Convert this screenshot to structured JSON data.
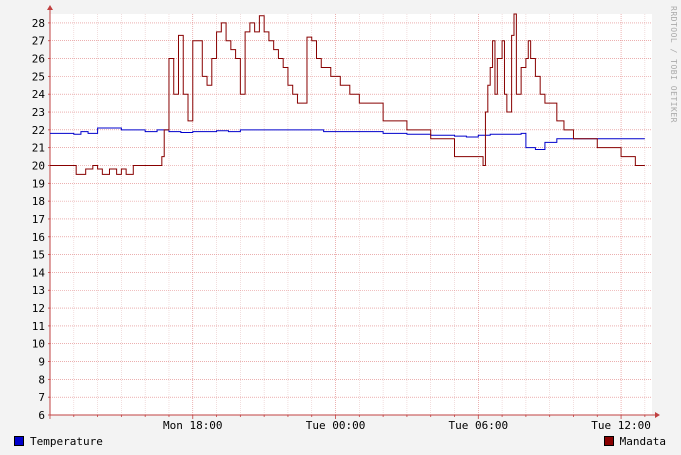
{
  "watermark": "RRDTOOL / TOBI OETIKER",
  "chart_data": {
    "type": "line",
    "xlabel": "",
    "ylabel": "",
    "ylim": [
      6,
      28.5
    ],
    "yticks": [
      6,
      7,
      8,
      9,
      10,
      11,
      12,
      13,
      14,
      15,
      16,
      17,
      18,
      19,
      20,
      21,
      22,
      23,
      24,
      25,
      26,
      27,
      28
    ],
    "xlim": [
      12,
      37.3
    ],
    "xticks": [
      {
        "x": 18,
        "label": "Mon 18:00"
      },
      {
        "x": 24,
        "label": "Tue 00:00"
      },
      {
        "x": 30,
        "label": "Tue 06:00"
      },
      {
        "x": 36,
        "label": "Tue 12:00"
      }
    ],
    "grid": true,
    "legend_position": "bottom",
    "series": [
      {
        "name": "Temperature",
        "color": "#0000cc",
        "points": [
          [
            12.0,
            21.8
          ],
          [
            12.5,
            21.8
          ],
          [
            13.0,
            21.75
          ],
          [
            13.3,
            21.9
          ],
          [
            13.6,
            21.8
          ],
          [
            14.0,
            22.1
          ],
          [
            14.5,
            22.1
          ],
          [
            15.0,
            22.0
          ],
          [
            15.5,
            22.0
          ],
          [
            16.0,
            21.9
          ],
          [
            16.5,
            22.0
          ],
          [
            17.0,
            21.9
          ],
          [
            17.5,
            21.85
          ],
          [
            18.0,
            21.9
          ],
          [
            18.5,
            21.9
          ],
          [
            19.0,
            21.95
          ],
          [
            19.5,
            21.9
          ],
          [
            20.0,
            22.0
          ],
          [
            20.5,
            22.0
          ],
          [
            21.0,
            22.0
          ],
          [
            21.5,
            22.0
          ],
          [
            22.0,
            22.0
          ],
          [
            22.5,
            22.0
          ],
          [
            23.0,
            22.0
          ],
          [
            23.5,
            21.9
          ],
          [
            24.0,
            21.9
          ],
          [
            24.5,
            21.9
          ],
          [
            25.0,
            21.9
          ],
          [
            25.5,
            21.9
          ],
          [
            26.0,
            21.8
          ],
          [
            27.0,
            21.75
          ],
          [
            28.0,
            21.7
          ],
          [
            29.0,
            21.65
          ],
          [
            29.5,
            21.6
          ],
          [
            30.0,
            21.7
          ],
          [
            30.5,
            21.75
          ],
          [
            31.0,
            21.75
          ],
          [
            31.5,
            21.75
          ],
          [
            31.8,
            21.8
          ],
          [
            32.0,
            21.0
          ],
          [
            32.4,
            20.9
          ],
          [
            32.8,
            21.3
          ],
          [
            33.3,
            21.5
          ],
          [
            33.8,
            21.5
          ],
          [
            34.5,
            21.5
          ],
          [
            35.0,
            21.5
          ],
          [
            35.5,
            21.5
          ],
          [
            36.0,
            21.5
          ],
          [
            36.5,
            21.5
          ],
          [
            37.0,
            21.5
          ]
        ]
      },
      {
        "name": "Mandata",
        "color": "#880000",
        "points": [
          [
            12.0,
            20.0
          ],
          [
            12.5,
            20.0
          ],
          [
            13.0,
            20.0
          ],
          [
            13.1,
            19.5
          ],
          [
            13.3,
            19.5
          ],
          [
            13.5,
            19.8
          ],
          [
            13.8,
            20.0
          ],
          [
            14.0,
            19.8
          ],
          [
            14.2,
            19.5
          ],
          [
            14.5,
            19.8
          ],
          [
            14.8,
            19.5
          ],
          [
            15.0,
            19.8
          ],
          [
            15.2,
            19.5
          ],
          [
            15.5,
            20.0
          ],
          [
            16.5,
            20.0
          ],
          [
            16.7,
            20.5
          ],
          [
            16.8,
            22.0
          ],
          [
            17.0,
            26.0
          ],
          [
            17.2,
            24.0
          ],
          [
            17.4,
            27.3
          ],
          [
            17.6,
            24.0
          ],
          [
            17.8,
            22.5
          ],
          [
            18.0,
            27.0
          ],
          [
            18.2,
            27.0
          ],
          [
            18.4,
            25.0
          ],
          [
            18.6,
            24.5
          ],
          [
            18.8,
            26.0
          ],
          [
            19.0,
            27.5
          ],
          [
            19.2,
            28.0
          ],
          [
            19.4,
            27.0
          ],
          [
            19.6,
            26.5
          ],
          [
            19.8,
            26.0
          ],
          [
            20.0,
            24.0
          ],
          [
            20.2,
            27.5
          ],
          [
            20.4,
            28.0
          ],
          [
            20.6,
            27.5
          ],
          [
            20.8,
            28.4
          ],
          [
            21.0,
            27.5
          ],
          [
            21.2,
            27.0
          ],
          [
            21.4,
            26.5
          ],
          [
            21.6,
            26.0
          ],
          [
            21.8,
            25.5
          ],
          [
            22.0,
            24.5
          ],
          [
            22.2,
            24.0
          ],
          [
            22.4,
            23.5
          ],
          [
            22.6,
            23.5
          ],
          [
            22.8,
            27.2
          ],
          [
            23.0,
            27.0
          ],
          [
            23.2,
            26.0
          ],
          [
            23.4,
            25.5
          ],
          [
            23.8,
            25.0
          ],
          [
            24.2,
            24.5
          ],
          [
            24.6,
            24.0
          ],
          [
            25.0,
            23.5
          ],
          [
            25.5,
            23.5
          ],
          [
            26.0,
            22.5
          ],
          [
            26.5,
            22.5
          ],
          [
            27.0,
            22.0
          ],
          [
            27.5,
            22.0
          ],
          [
            28.0,
            21.5
          ],
          [
            29.0,
            20.5
          ],
          [
            30.0,
            20.5
          ],
          [
            30.2,
            20.0
          ],
          [
            30.3,
            23.0
          ],
          [
            30.4,
            24.5
          ],
          [
            30.5,
            25.5
          ],
          [
            30.6,
            27.0
          ],
          [
            30.7,
            24.0
          ],
          [
            30.8,
            26.0
          ],
          [
            31.0,
            27.0
          ],
          [
            31.1,
            24.0
          ],
          [
            31.2,
            23.0
          ],
          [
            31.4,
            27.3
          ],
          [
            31.5,
            28.5
          ],
          [
            31.6,
            24.0
          ],
          [
            31.8,
            25.5
          ],
          [
            32.0,
            26.0
          ],
          [
            32.1,
            27.0
          ],
          [
            32.2,
            26.0
          ],
          [
            32.4,
            25.0
          ],
          [
            32.6,
            24.0
          ],
          [
            32.8,
            23.5
          ],
          [
            33.0,
            23.5
          ],
          [
            33.3,
            22.5
          ],
          [
            33.6,
            22.0
          ],
          [
            34.0,
            21.5
          ],
          [
            34.5,
            21.5
          ],
          [
            35.0,
            21.0
          ],
          [
            35.5,
            21.0
          ],
          [
            36.0,
            20.5
          ],
          [
            36.3,
            20.5
          ],
          [
            36.6,
            20.0
          ],
          [
            37.0,
            20.0
          ]
        ]
      }
    ]
  },
  "legend": {
    "temperature": {
      "label": "Temperature",
      "color": "#0000cc"
    },
    "mandata": {
      "label": "Mandata",
      "color": "#880000"
    }
  }
}
